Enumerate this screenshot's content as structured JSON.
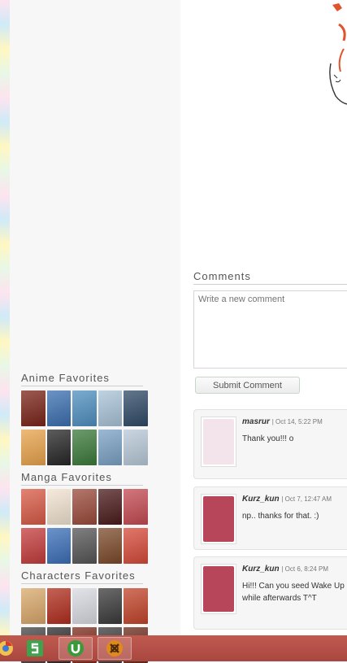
{
  "sidebar": {
    "anime_favorites_title": "Anime Favorites",
    "manga_favorites_title": "Manga Favorites",
    "characters_favorites_title": "Characters Favorites",
    "anime_thumbs": [
      "#7a2418",
      "#3b6fb0",
      "#4f8fbf",
      "#a9c3d8",
      "#2f4a66",
      "#e8a34b",
      "#262626",
      "#3b7a3a",
      "#7aa1c4",
      "#b8c9d8"
    ],
    "manga_thumbs": [
      "#d85a46",
      "#f1e3d0",
      "#9a4a3a",
      "#4a1a1a",
      "#c44a52",
      "#c43c3c",
      "#3b6fb8",
      "#555555",
      "#7b4a2a",
      "#d64a3a"
    ],
    "character_thumbs": [
      "#d9a86a",
      "#b02e1e",
      "#d9d9e2",
      "#3a3a3a",
      "#c2442a",
      "#444444",
      "#2a2a2a",
      "#7a2a1a",
      "#3a3a3a",
      "#6a2a1a"
    ]
  },
  "comments": {
    "title": "Comments",
    "placeholder": "Write a new comment",
    "submit_label": "Submit Comment",
    "items": [
      {
        "user": "masrur",
        "date": "| Oct 14, 5:22 PM",
        "text": "Thank you!!! o",
        "avatar_color": "#f3e3ea"
      },
      {
        "user": "Kurz_kun",
        "date": "| Oct 7, 12:47 AM",
        "text": "np.. thanks for that. :)",
        "avatar_color": "#b8465a"
      },
      {
        "user": "Kurz_kun",
        "date": "| Oct 6, 8:24 PM",
        "text": "Hi!!! Can you seed Wake Up\nwhile afterwards T^T",
        "avatar_color": "#b8465a"
      }
    ]
  },
  "taskbar": {
    "apps": [
      "browser-icon",
      "green-s-app-icon",
      "utorrent-icon",
      "game-app-icon"
    ],
    "accent": "#b04c43"
  }
}
